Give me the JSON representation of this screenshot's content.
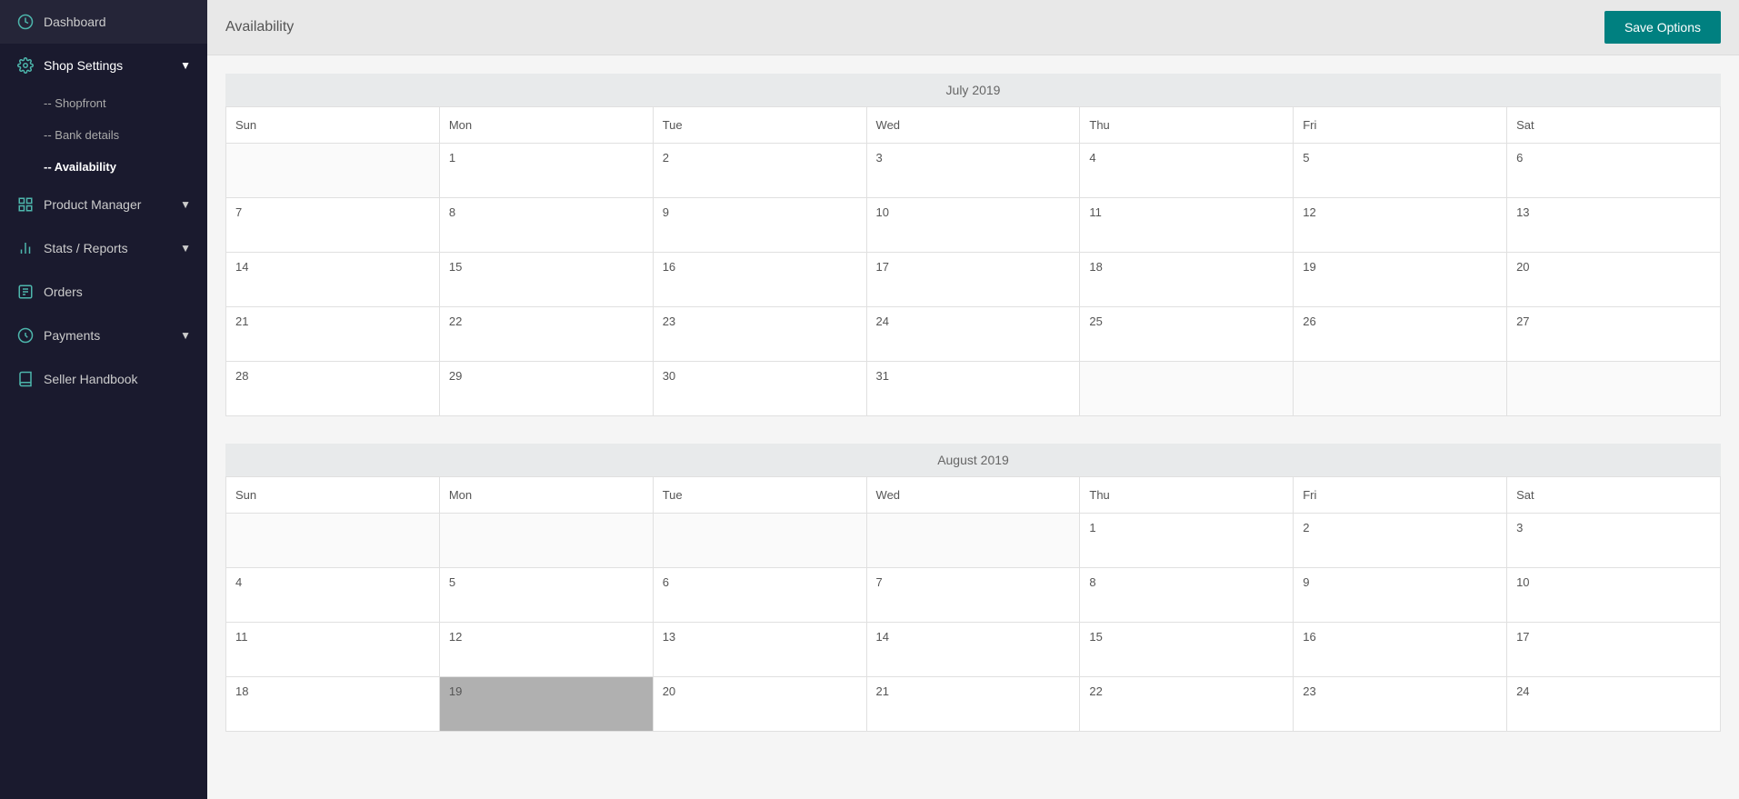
{
  "sidebar": {
    "items": [
      {
        "id": "dashboard",
        "label": "Dashboard",
        "icon": "dashboard-icon",
        "hasChevron": false
      },
      {
        "id": "shop-settings",
        "label": "Shop Settings",
        "icon": "settings-icon",
        "hasChevron": true,
        "expanded": true
      },
      {
        "id": "product-manager",
        "label": "Product Manager",
        "icon": "product-icon",
        "hasChevron": true,
        "expanded": false
      },
      {
        "id": "stats-reports",
        "label": "Stats / Reports",
        "icon": "stats-icon",
        "hasChevron": true,
        "expanded": false
      },
      {
        "id": "orders",
        "label": "Orders",
        "icon": "orders-icon",
        "hasChevron": false
      },
      {
        "id": "payments",
        "label": "Payments",
        "icon": "payments-icon",
        "hasChevron": true,
        "expanded": false
      },
      {
        "id": "seller-handbook",
        "label": "Seller Handbook",
        "icon": "handbook-icon",
        "hasChevron": false
      }
    ],
    "sub_items": {
      "shop-settings": [
        {
          "label": "-- Shopfront",
          "active": false
        },
        {
          "label": "-- Bank details",
          "active": false
        },
        {
          "label": "-- Availability",
          "active": true
        }
      ]
    }
  },
  "header": {
    "title": "Availability",
    "save_button_label": "Save Options"
  },
  "calendar": {
    "months": [
      {
        "label": "July 2019",
        "days": [
          "Sun",
          "Mon",
          "Tue",
          "Wed",
          "Thu",
          "Fri",
          "Sat"
        ],
        "weeks": [
          [
            "",
            "1",
            "2",
            "3",
            "4",
            "5",
            "6"
          ],
          [
            "7",
            "8",
            "9",
            "10",
            "11",
            "12",
            "13"
          ],
          [
            "14",
            "15",
            "16",
            "17",
            "18",
            "19",
            "20"
          ],
          [
            "21",
            "22",
            "23",
            "24",
            "25",
            "26",
            "27"
          ],
          [
            "28",
            "29",
            "30",
            "31",
            "",
            "",
            ""
          ]
        ],
        "highlighted": []
      },
      {
        "label": "August 2019",
        "days": [
          "Sun",
          "Mon",
          "Tue",
          "Wed",
          "Thu",
          "Fri",
          "Sat"
        ],
        "weeks": [
          [
            "",
            "",
            "",
            "",
            "1",
            "2",
            "3"
          ],
          [
            "4",
            "5",
            "6",
            "7",
            "8",
            "9",
            "10"
          ],
          [
            "11",
            "12",
            "13",
            "14",
            "15",
            "16",
            "17"
          ],
          [
            "18",
            "19",
            "20",
            "21",
            "22",
            "23",
            "24"
          ]
        ],
        "highlighted": [
          {
            "week": 3,
            "day": 1
          }
        ]
      }
    ]
  }
}
